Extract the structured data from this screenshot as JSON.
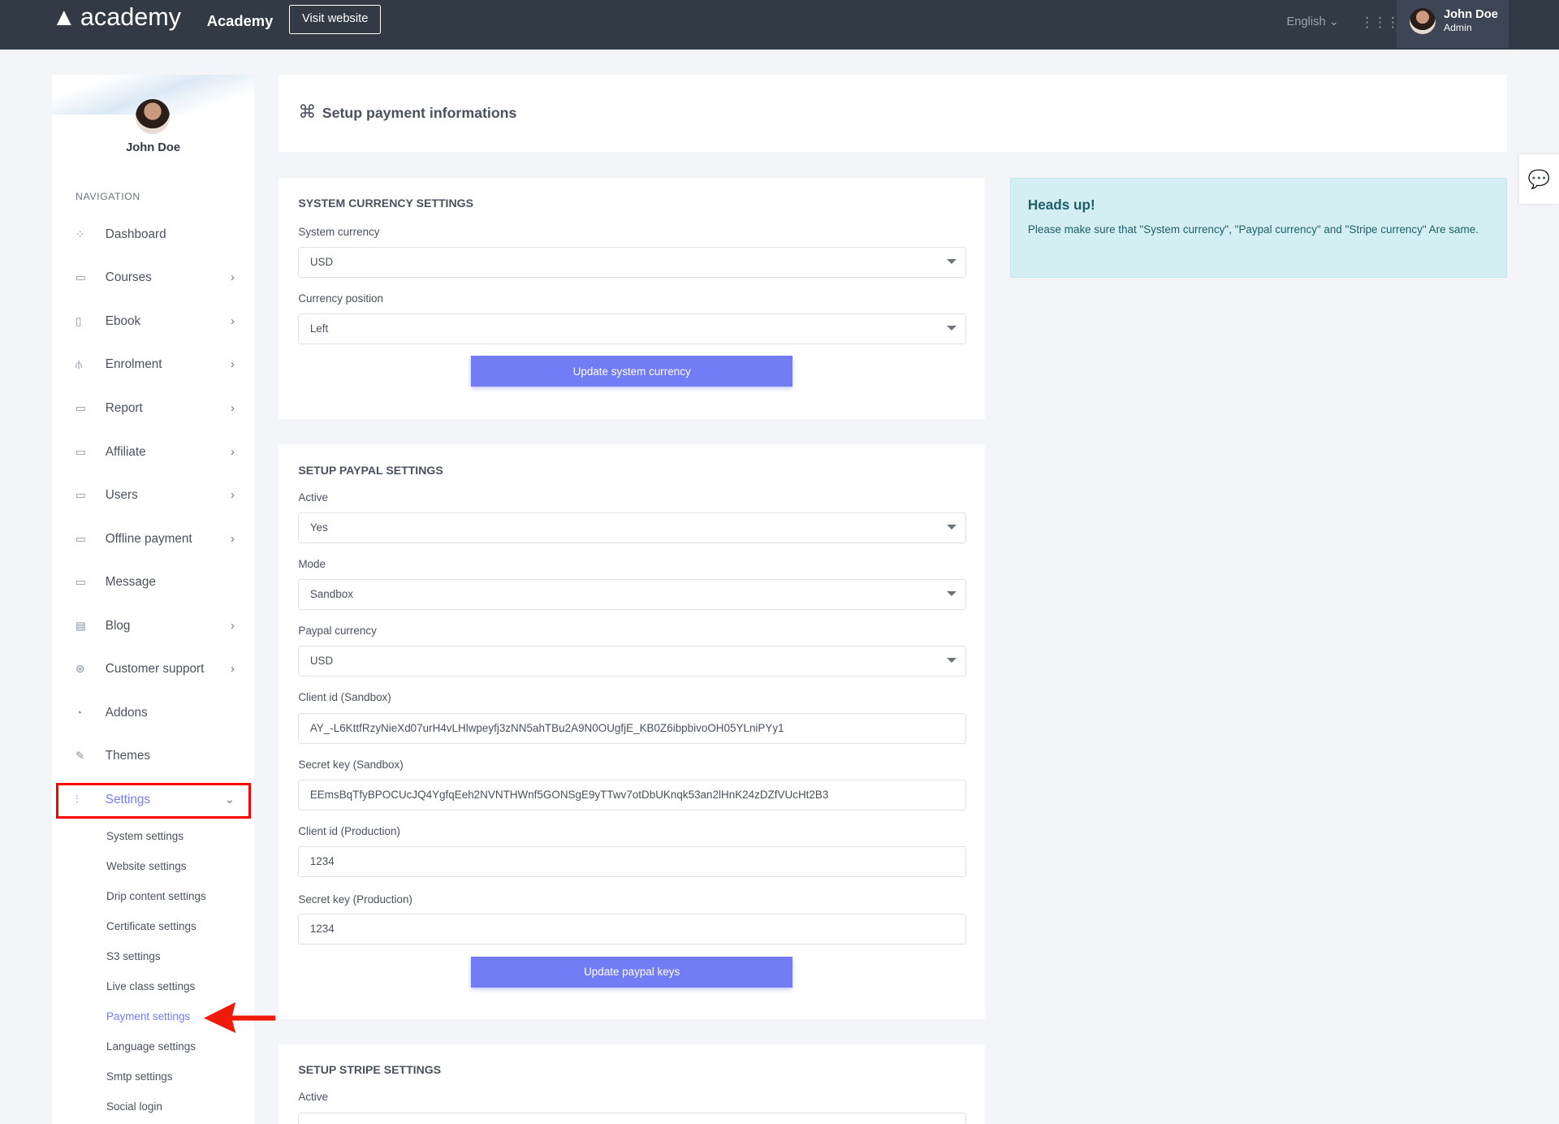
{
  "header": {
    "logo": "academy",
    "brand": "Academy",
    "visit_label": "Visit website",
    "language": "English",
    "user_name": "John Doe",
    "user_role": "Admin"
  },
  "sidebar": {
    "user_name": "John Doe",
    "nav_heading": "NAVIGATION",
    "items": [
      {
        "label": "Dashboard",
        "icon": "grid-icon"
      },
      {
        "label": "Courses",
        "icon": "archive-icon"
      },
      {
        "label": "Ebook",
        "icon": "book-icon"
      },
      {
        "label": "Enrolment",
        "icon": "network-icon"
      },
      {
        "label": "Report",
        "icon": "archive-icon"
      },
      {
        "label": "Affiliate",
        "icon": "archive-icon"
      },
      {
        "label": "Users",
        "icon": "archive-icon"
      },
      {
        "label": "Offline payment",
        "icon": "archive-icon"
      },
      {
        "label": "Message",
        "icon": "message-icon"
      },
      {
        "label": "Blog",
        "icon": "document-icon"
      },
      {
        "label": "Customer support",
        "icon": "lifebuoy-icon"
      },
      {
        "label": "Addons",
        "icon": "addon-icon"
      },
      {
        "label": "Themes",
        "icon": "brush-icon"
      },
      {
        "label": "Settings",
        "icon": "sliders-icon"
      }
    ],
    "settings_sub": [
      "System settings",
      "Website settings",
      "Drip content settings",
      "Certificate settings",
      "S3 settings",
      "Live class settings",
      "Payment settings",
      "Language settings",
      "Smtp settings",
      "Social login"
    ]
  },
  "page": {
    "title": "Setup payment informations"
  },
  "currency": {
    "heading": "SYSTEM CURRENCY SETTINGS",
    "system_currency_label": "System currency",
    "system_currency": "USD",
    "position_label": "Currency position",
    "position": "Left",
    "button": "Update system currency"
  },
  "paypal": {
    "heading": "SETUP PAYPAL SETTINGS",
    "active_label": "Active",
    "active": "Yes",
    "mode_label": "Mode",
    "mode": "Sandbox",
    "currency_label": "Paypal currency",
    "currency": "USD",
    "client_sandbox_label": "Client id (Sandbox)",
    "client_sandbox": "AY_-L6KttfRzyNieXd07urH4vLHlwpeyfj3zNN5ahTBu2A9N0OUgfjE_KB0Z6ibpbivoOH05YLniPYy1",
    "secret_sandbox_label": "Secret key (Sandbox)",
    "secret_sandbox": "EEmsBqTfyBPOCUcJQ4YgfqEeh2NVNTHWnf5GONSgE9yTTwv7otDbUKnqk53an2lHnK24zDZfVUcHt2B3",
    "client_prod_label": "Client id (Production)",
    "client_prod": "1234",
    "secret_prod_label": "Secret key (Production)",
    "secret_prod": "1234",
    "button": "Update paypal keys"
  },
  "stripe": {
    "heading": "SETUP STRIPE SETTINGS",
    "active_label": "Active"
  },
  "alert": {
    "title": "Heads up!",
    "text": "Please make sure that \"System currency\", \"Paypal currency\" and \"Stripe currency\" Are same."
  }
}
